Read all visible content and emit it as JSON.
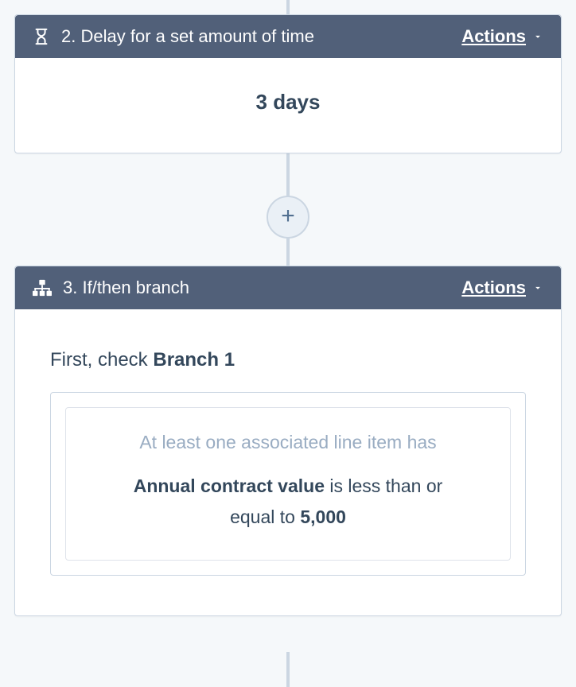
{
  "step2": {
    "number": "2.",
    "title": "Delay for a set amount of time",
    "actions_label": "Actions",
    "delay_value": "3 days"
  },
  "step3": {
    "number": "3.",
    "title": "If/then branch",
    "actions_label": "Actions",
    "check_prefix": "First, check ",
    "branch_name": "Branch 1",
    "condition_header": "At least one associated line item has",
    "condition_field": "Annual contract value",
    "condition_operator_part1": " is less than or",
    "condition_operator_part2": "equal to ",
    "condition_value": "5,000"
  },
  "add_button_label": "+"
}
